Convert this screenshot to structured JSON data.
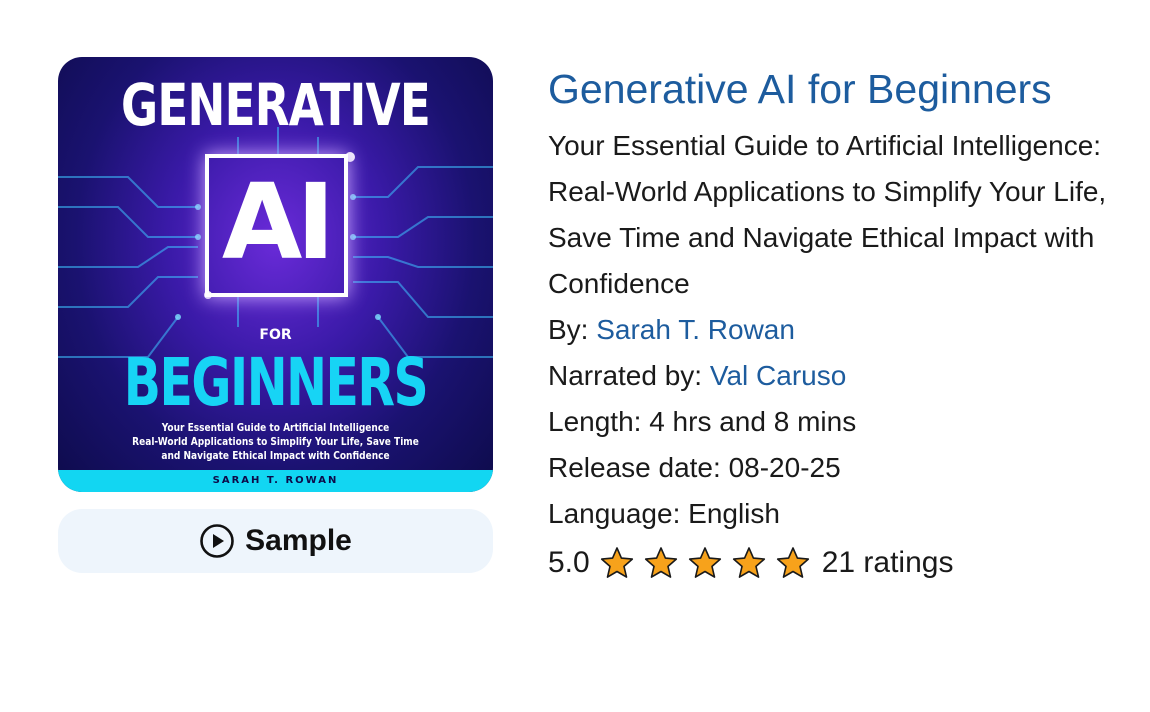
{
  "cover": {
    "title": "GENERATIVE",
    "ai": "AI",
    "for": "FOR",
    "beginners": "BEGINNERS",
    "subtitle_lines": [
      "Your Essential Guide to Artificial Intelligence",
      "Real-World Applications to Simplify Your Life, Save Time",
      "and Navigate Ethical Impact with Confidence"
    ],
    "author": "SARAH T. ROWAN",
    "accent_color": "#17d4f5"
  },
  "sample": {
    "label": "Sample",
    "icon": "play-circle-icon"
  },
  "book": {
    "title": "Generative AI for Beginners",
    "subtitle": "Your Essential Guide to Artificial Intelligence: Real-World Applications to Simplify Your Life, Save Time and Navigate Ethical Impact with Confidence",
    "by_label": "By: ",
    "author": "Sarah T. Rowan",
    "narrated_label": "Narrated by: ",
    "narrator": "Val Caruso",
    "length_label": "Length: ",
    "length": "4 hrs and 8 mins",
    "release_label": "Release date: ",
    "release_date": "08-20-25",
    "language_label": "Language: ",
    "language": "English",
    "rating": "5.0",
    "stars": 5,
    "star_color": "#f7a21b",
    "ratings_count": "21 ratings",
    "link_color": "#1d5c9e"
  }
}
